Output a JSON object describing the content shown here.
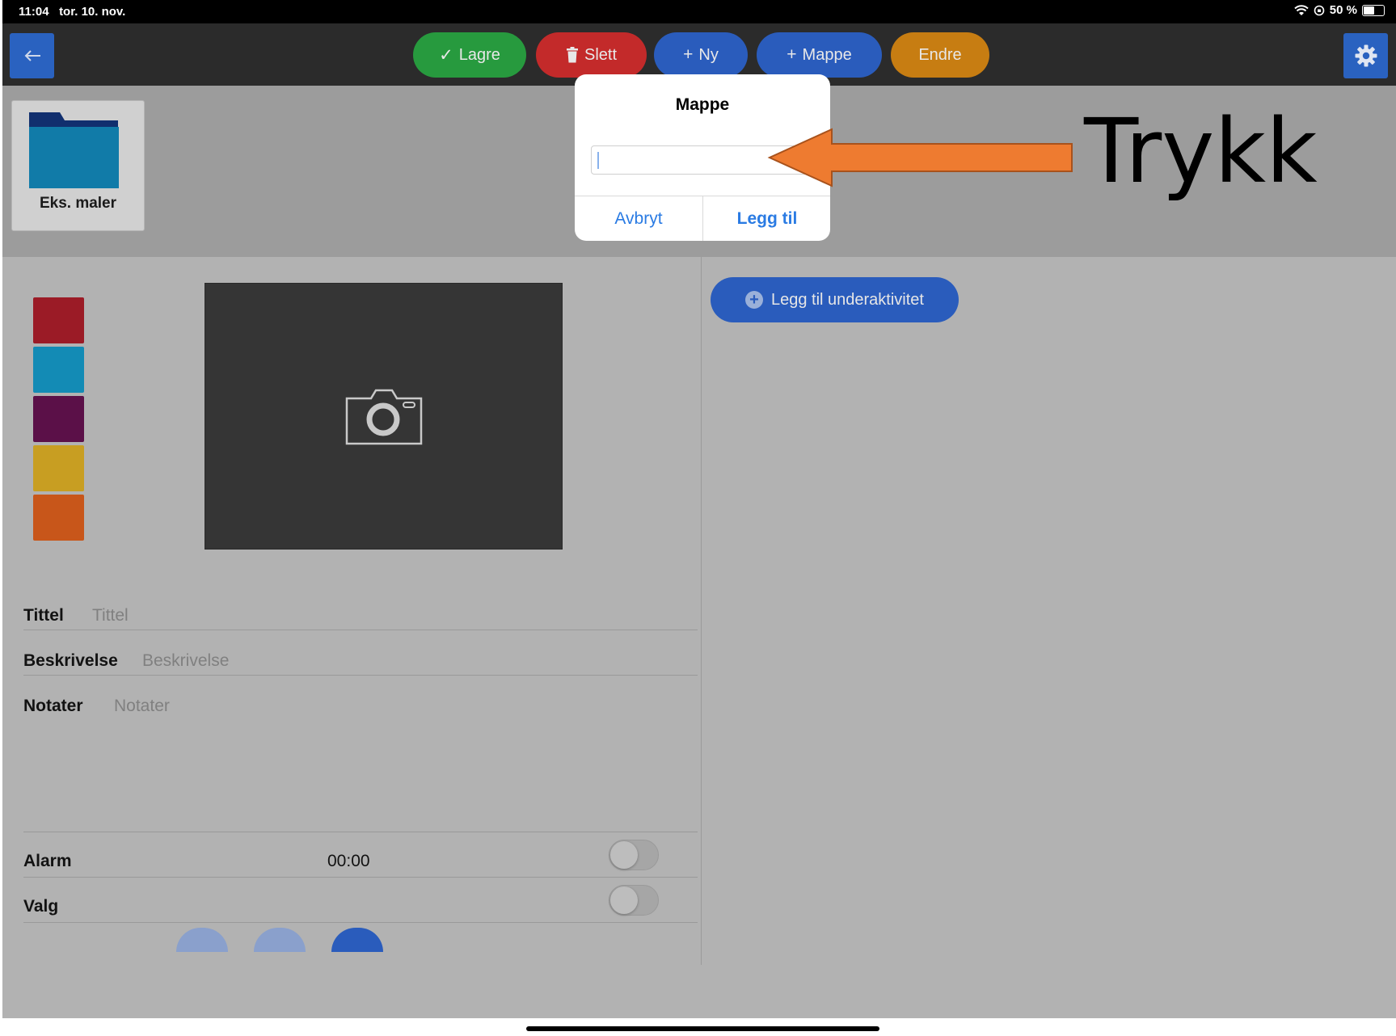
{
  "status_bar": {
    "time": "11:04",
    "date": "tor. 10. nov.",
    "battery": "50 %",
    "battery_level": 0.5
  },
  "toolbar": {
    "save_label": "Lagre",
    "delete_label": "Slett",
    "new_label": "Ny",
    "folder_label": "Mappe",
    "edit_label": "Endre",
    "colors": {
      "save": "#28a745",
      "delete": "#d92b2b",
      "new": "#2a5cbc",
      "folder": "#2a5cbc",
      "edit": "#d98b13"
    }
  },
  "folders": [
    {
      "name": "Eks. maler",
      "icon": "folder-icon"
    }
  ],
  "swatches": [
    "#9b1b26",
    "#138bb5",
    "#5b1048",
    "#c89e22",
    "#c8561a"
  ],
  "form": {
    "title_label": "Tittel",
    "title_placeholder": "Tittel",
    "description_label": "Beskrivelse",
    "description_placeholder": "Beskrivelse",
    "notes_label": "Notater",
    "notes_placeholder": "Notater",
    "alarm_label": "Alarm",
    "alarm_time": "00:00",
    "alarm_enabled": false,
    "choice_label": "Valg",
    "choice_enabled": false
  },
  "right_panel": {
    "add_subactivity_label": "Legg til underaktivitet"
  },
  "dialog": {
    "title": "Mappe",
    "input_value": "",
    "cancel_label": "Avbryt",
    "confirm_label": "Legg til"
  },
  "annotation": {
    "text": "Trykk",
    "arrow_color": "#ee7b30"
  }
}
